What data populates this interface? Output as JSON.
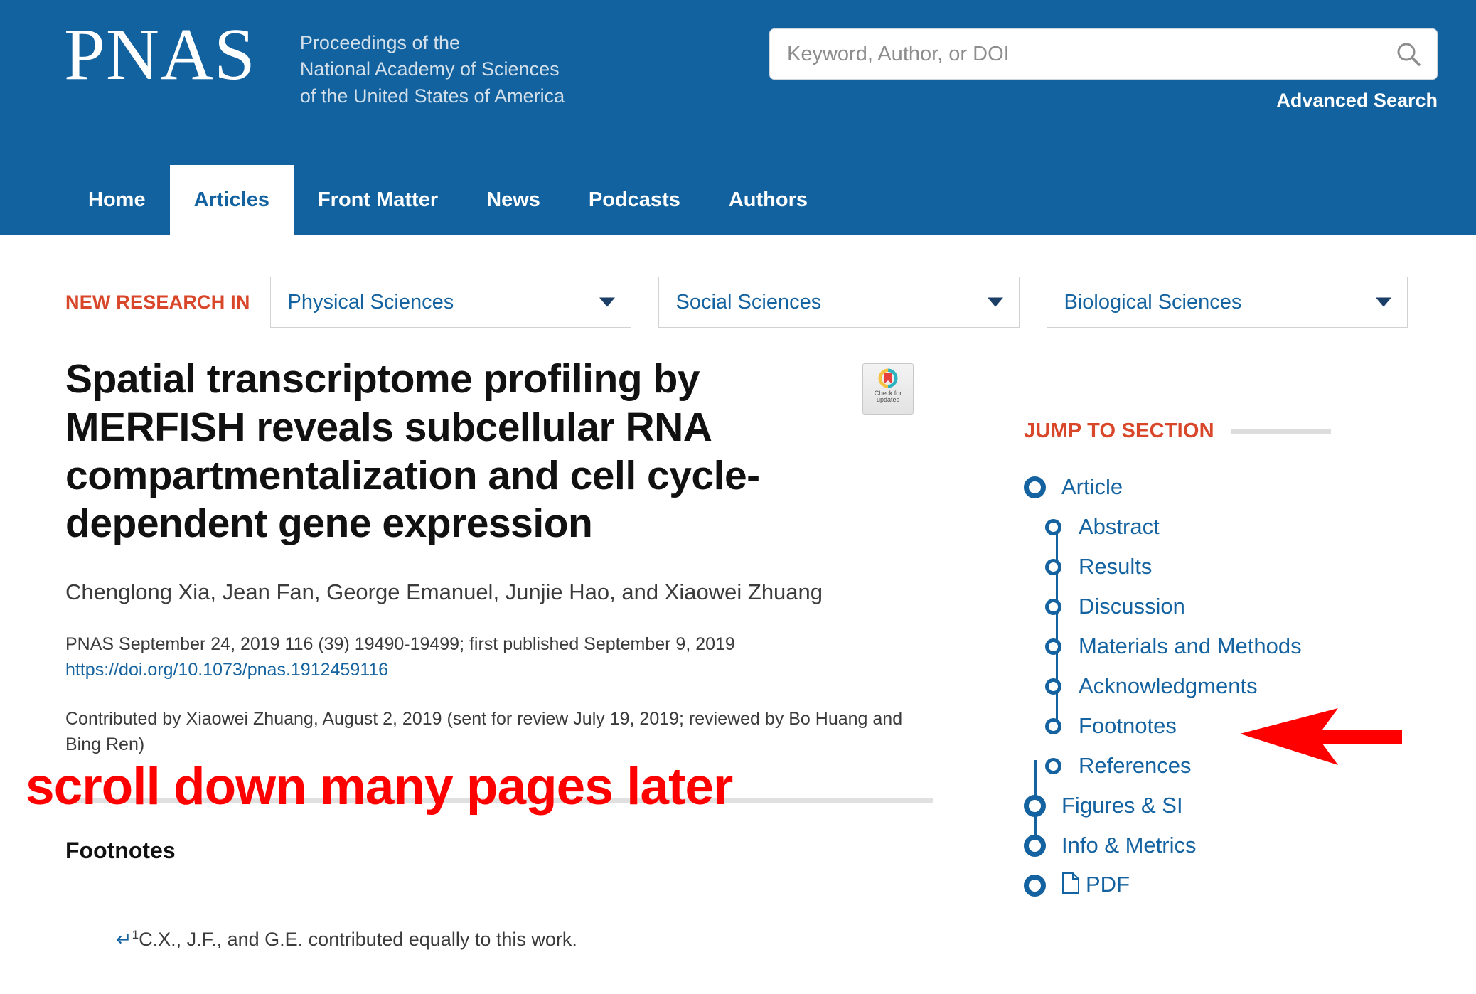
{
  "header": {
    "logo_word": "PNAS",
    "tagline": "Proceedings of the\nNational Academy of Sciences\nof the United States of America",
    "search": {
      "placeholder": "Keyword, Author, or DOI",
      "value": "",
      "icon": "search-icon"
    },
    "advanced_search": "Advanced Search",
    "background_color": "#1262A0"
  },
  "nav": {
    "items": [
      {
        "label": "Home",
        "active": false
      },
      {
        "label": "Articles",
        "active": true
      },
      {
        "label": "Front Matter",
        "active": false
      },
      {
        "label": "News",
        "active": false
      },
      {
        "label": "Podcasts",
        "active": false
      },
      {
        "label": "Authors",
        "active": false
      }
    ]
  },
  "research_bar": {
    "label": "NEW RESEARCH IN",
    "label_color": "#D9472B",
    "dropdowns": [
      {
        "selected": "Physical Sciences"
      },
      {
        "selected": "Social Sciences"
      },
      {
        "selected": "Biological Sciences"
      }
    ]
  },
  "article": {
    "title": "Spatial transcriptome profiling by MERFISH reveals subcellular RNA compartmentalization and cell cycle-dependent gene expression",
    "authors": "Chenglong Xia, Jean Fan, George Emanuel, Junjie Hao, and Xiaowei Zhuang",
    "citation": "PNAS September 24, 2019 116 (39) 19490-19499; first published September 9, 2019",
    "doi": "https://doi.org/10.1073/pnas.1912459116",
    "contributed": "Contributed by Xiaowei Zhuang, August 2, 2019 (sent for review July 19, 2019; reviewed by Bo Huang and Bing Ren)"
  },
  "crossmark": {
    "label": "Check for\nupdates",
    "colors": {
      "teal": "#2BB3C0",
      "yellow": "#F5C242",
      "red": "#E8403A"
    }
  },
  "annotation": {
    "scroll_note": "scroll down many pages later",
    "scroll_note_color": "#FF0000",
    "arrow": "left-arrow",
    "arrow_color": "#FF0000"
  },
  "footnotes": {
    "heading": "Footnotes",
    "items": [
      {
        "return_symbol": "↵",
        "marker": "1",
        "text": "C.X., J.F., and G.E. contributed equally to this work."
      }
    ]
  },
  "jump_to_section": {
    "title": "JUMP TO SECTION",
    "title_color": "#D9472B",
    "link_color": "#1463A0",
    "items": [
      {
        "label": "Article",
        "level": 1
      },
      {
        "label": "Abstract",
        "level": 2
      },
      {
        "label": "Results",
        "level": 2
      },
      {
        "label": "Discussion",
        "level": 2
      },
      {
        "label": "Materials and Methods",
        "level": 2
      },
      {
        "label": "Acknowledgments",
        "level": 2
      },
      {
        "label": "Footnotes",
        "level": 2
      },
      {
        "label": "References",
        "level": 2
      },
      {
        "label": "Figures & SI",
        "level": 1
      },
      {
        "label": "Info & Metrics",
        "level": 1
      },
      {
        "label": "PDF",
        "level": 1,
        "icon": "pdf-file-icon"
      }
    ]
  }
}
